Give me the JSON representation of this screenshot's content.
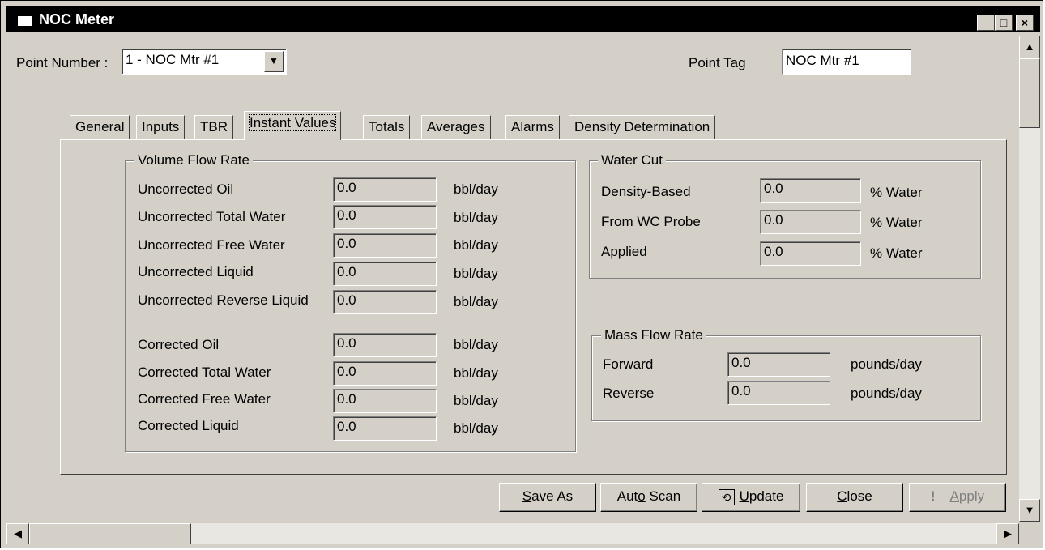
{
  "window": {
    "title": "NOC Meter",
    "buttons": {
      "minimize": "_",
      "maximize": "□",
      "close": "×"
    }
  },
  "header": {
    "point_number_label": "Point Number :",
    "point_number_value": "1 - NOC Mtr #1",
    "point_tag_label": "Point Tag",
    "point_tag_value": "NOC Mtr #1"
  },
  "tabs": [
    {
      "label": "General",
      "active": false
    },
    {
      "label": "Inputs",
      "active": false
    },
    {
      "label": "TBR",
      "active": false
    },
    {
      "label": "Instant Values",
      "active": true
    },
    {
      "label": "Totals",
      "active": false
    },
    {
      "label": "Averages",
      "active": false
    },
    {
      "label": "Alarms",
      "active": false
    },
    {
      "label": "Density Determination",
      "active": false
    }
  ],
  "volume_flow": {
    "title": "Volume Flow Rate",
    "rows": [
      {
        "label": "Uncorrected Oil",
        "value": "0.0",
        "unit": "bbl/day"
      },
      {
        "label": "Uncorrected Total Water",
        "value": "0.0",
        "unit": "bbl/day"
      },
      {
        "label": "Uncorrected Free Water",
        "value": "0.0",
        "unit": "bbl/day"
      },
      {
        "label": "Uncorrected Liquid",
        "value": "0.0",
        "unit": "bbl/day"
      },
      {
        "label": "Uncorrected Reverse Liquid",
        "value": "0.0",
        "unit": "bbl/day"
      },
      {
        "label": "Corrected Oil",
        "value": "0.0",
        "unit": "bbl/day"
      },
      {
        "label": "Corrected Total Water",
        "value": "0.0",
        "unit": "bbl/day"
      },
      {
        "label": "Corrected Free Water",
        "value": "0.0",
        "unit": "bbl/day"
      },
      {
        "label": "Corrected Liquid",
        "value": "0.0",
        "unit": "bbl/day"
      }
    ]
  },
  "water_cut": {
    "title": "Water Cut",
    "rows": [
      {
        "label": "Density-Based",
        "value": "0.0",
        "unit": "% Water"
      },
      {
        "label": "From WC Probe",
        "value": "0.0",
        "unit": "% Water"
      },
      {
        "label": "Applied",
        "value": "0.0",
        "unit": "% Water"
      }
    ]
  },
  "mass_flow": {
    "title": "Mass Flow Rate",
    "rows": [
      {
        "label": "Forward",
        "value": "0.0",
        "unit": "pounds/day"
      },
      {
        "label": "Reverse",
        "value": "0.0",
        "unit": "pounds/day"
      }
    ]
  },
  "buttons": {
    "save_as": {
      "pre": "",
      "u": "S",
      "post": "ave As"
    },
    "auto_scan": {
      "pre": "Aut",
      "u": "o",
      "post": " Scan"
    },
    "update": {
      "pre": "",
      "u": "U",
      "post": "pdate"
    },
    "close": {
      "pre": "",
      "u": "C",
      "post": "lose"
    },
    "apply": {
      "pre": "",
      "u": "A",
      "post": "pply"
    }
  },
  "icons": {
    "combo_arrow": "▼",
    "update_icon": "⟲",
    "apply_icon": "!",
    "scroll_up": "▲",
    "scroll_down": "▼",
    "scroll_left": "◀",
    "scroll_right": "▶"
  }
}
